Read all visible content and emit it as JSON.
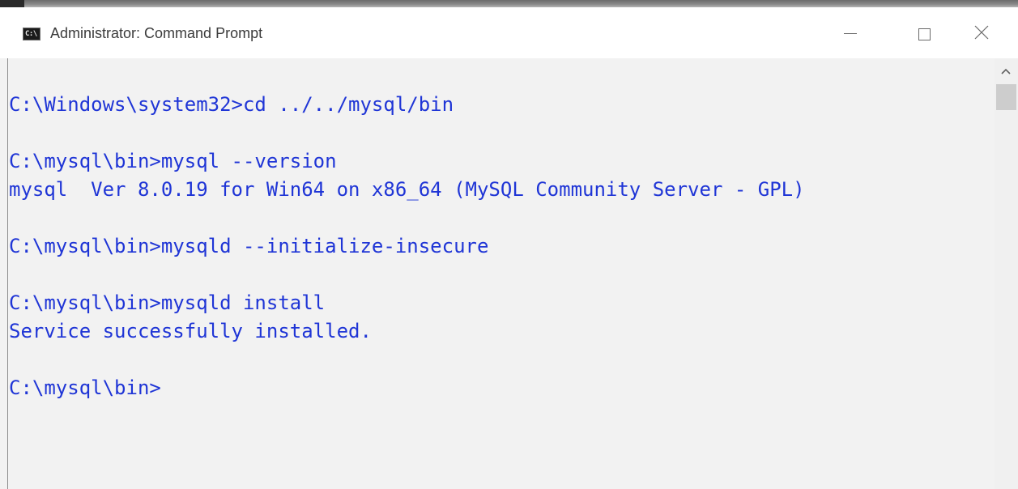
{
  "window": {
    "title": "Administrator: Command Prompt",
    "icon": "cmd-icon",
    "icon_text": "C:\\",
    "controls": {
      "minimize": "minimize-icon",
      "maximize": "maximize-icon",
      "close": "close-icon"
    }
  },
  "console": {
    "text_color": "#1f35d6",
    "background": "#f2f2f2",
    "lines": [
      "C:\\Windows\\system32>cd ../../mysql/bin",
      "",
      "C:\\mysql\\bin>mysql --version",
      "mysql  Ver 8.0.19 for Win64 on x86_64 (MySQL Community Server - GPL)",
      "",
      "C:\\mysql\\bin>mysqld --initialize-insecure",
      "",
      "C:\\mysql\\bin>mysqld install",
      "Service successfully installed.",
      "",
      "C:\\mysql\\bin>"
    ]
  },
  "scrollbar": {
    "up_arrow": "chevron-up-icon"
  }
}
